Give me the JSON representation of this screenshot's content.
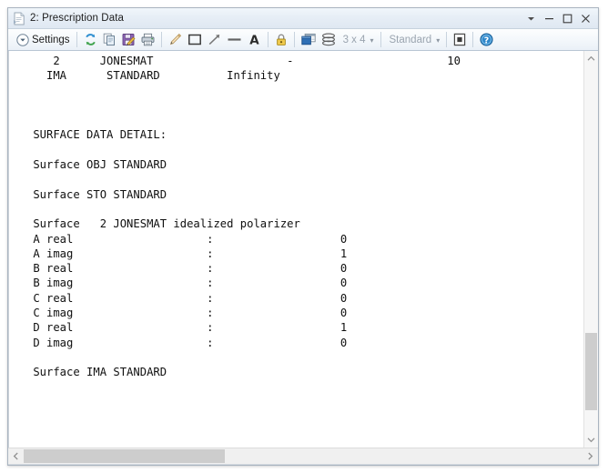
{
  "window": {
    "title": "2: Prescription Data",
    "icon": "document-icon",
    "controls": [
      {
        "name": "dropdown-arrow",
        "glyph": "▼"
      },
      {
        "name": "minimize",
        "glyph": "–"
      },
      {
        "name": "maximize",
        "glyph": "□"
      },
      {
        "name": "close",
        "glyph": "✕"
      }
    ]
  },
  "toolbar": {
    "settings_label": "Settings",
    "settings_icon": "chevron-down-circle-icon",
    "items": [
      {
        "name": "refresh-icon",
        "label": ""
      },
      {
        "name": "copy-icon",
        "label": ""
      },
      {
        "name": "save-icon",
        "label": ""
      },
      {
        "name": "print-icon",
        "label": ""
      },
      {
        "name": "pencil-icon",
        "label": ""
      },
      {
        "name": "rectangle-icon",
        "label": ""
      },
      {
        "name": "arrow-icon",
        "label": ""
      },
      {
        "name": "line-icon",
        "label": ""
      },
      {
        "name": "text-annotation-icon",
        "label": "A"
      },
      {
        "name": "lock-icon",
        "label": ""
      },
      {
        "name": "window-icon",
        "label": ""
      },
      {
        "name": "layers-icon",
        "label": ""
      }
    ],
    "grid_label": "3 x 4",
    "style_label": "Standard",
    "fullscreen_icon": "fullscreen-icon",
    "help_icon": "help-icon"
  },
  "text_report": "    2      JONESMAT                    -                       10\n   IMA      STANDARD          Infinity\n\n\n\n SURFACE DATA DETAIL:\n\n Surface OBJ STANDARD\n\n Surface STO STANDARD\n\n Surface   2 JONESMAT idealized polarizer\n A real                    :                   0\n A imag                    :                   1\n B real                    :                   0\n B imag                    :                   0\n C real                    :                   0\n C imag                    :                   0\n D real                    :                   1\n D imag                    :                   0\n\n Surface IMA STANDARD\n",
  "scrollbars": {
    "vertical": {
      "up_glyph": "⌃",
      "down_glyph": "⌄",
      "thumb_top_pct": 73,
      "thumb_height_pct": 21
    },
    "horizontal": {
      "left_glyph": "‹",
      "right_glyph": "›",
      "thumb_left_pct": 0,
      "thumb_width_pct": 36
    }
  },
  "colors": {
    "frame_border": "#a9b4c0",
    "titlebar_top": "#f1f6fb",
    "titlebar_bottom": "#dfe8f2",
    "toolbar_bottom": "#eaf0f7",
    "content_bg": "#ffffff",
    "text": "#101010",
    "scroll_thumb": "#cdcdcd",
    "dim_text": "#9aa4af"
  }
}
